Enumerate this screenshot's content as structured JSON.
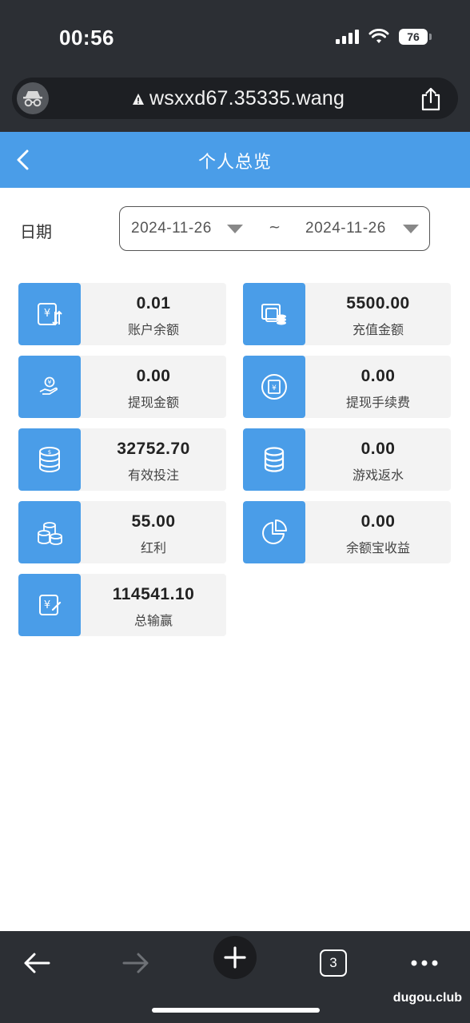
{
  "status_bar": {
    "time": "00:56",
    "battery": "76"
  },
  "browser": {
    "url": "wsxxd67.35335.wang",
    "tab_count": "3"
  },
  "header": {
    "title": "个人总览"
  },
  "date_filter": {
    "label": "日期",
    "start": "2024-11-26",
    "separator": "~",
    "end": "2024-11-26"
  },
  "stats": [
    {
      "value": "0.01",
      "label": "账户余额",
      "icon": "yuan-transfer-icon"
    },
    {
      "value": "5500.00",
      "label": "充值金额",
      "icon": "deposit-icon"
    },
    {
      "value": "0.00",
      "label": "提现金额",
      "icon": "withdraw-hand-icon"
    },
    {
      "value": "0.00",
      "label": "提现手续费",
      "icon": "fee-receipt-icon"
    },
    {
      "value": "32752.70",
      "label": "有效投注",
      "icon": "coin-stack-icon"
    },
    {
      "value": "0.00",
      "label": "游戏返水",
      "icon": "database-stack-icon"
    },
    {
      "value": "55.00",
      "label": "红利",
      "icon": "coins-icon"
    },
    {
      "value": "0.00",
      "label": "余额宝收益",
      "icon": "pie-chart-icon"
    },
    {
      "value": "114541.10",
      "label": "总输赢",
      "icon": "yuan-edit-icon"
    }
  ],
  "watermark": "dugou.club",
  "colors": {
    "accent": "#4a9de8",
    "chrome": "#2c2f34",
    "card_bg": "#f3f3f3"
  }
}
